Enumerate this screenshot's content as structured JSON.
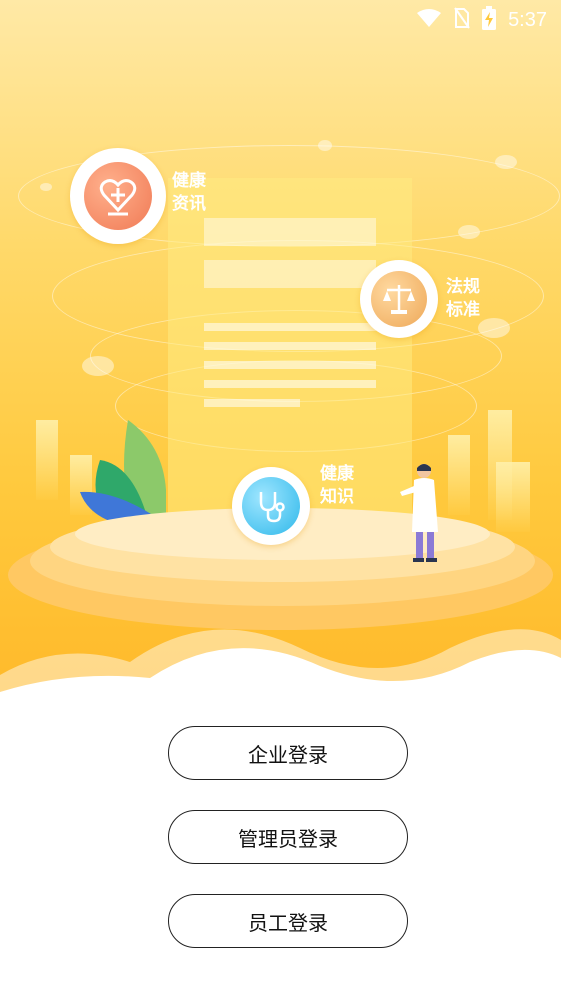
{
  "status_bar": {
    "time": "5:37",
    "icons": [
      "wifi-icon",
      "no-sim-icon",
      "battery-charging-icon"
    ]
  },
  "features": [
    {
      "label": "健康资讯",
      "icon": "heart-plus-icon"
    },
    {
      "label": "法规标准",
      "icon": "scales-icon"
    },
    {
      "label": "健康知识",
      "icon": "stethoscope-icon"
    }
  ],
  "buttons": {
    "enterprise_login": "企业登录",
    "admin_login": "管理员登录",
    "employee_login": "员工登录"
  },
  "colors": {
    "hero_top": "#ffe9a6",
    "hero_bottom": "#ffb92a",
    "heart_badge": "#f08a65",
    "scales_badge": "#f1b66a",
    "stethoscope_badge": "#3fc4ee"
  }
}
